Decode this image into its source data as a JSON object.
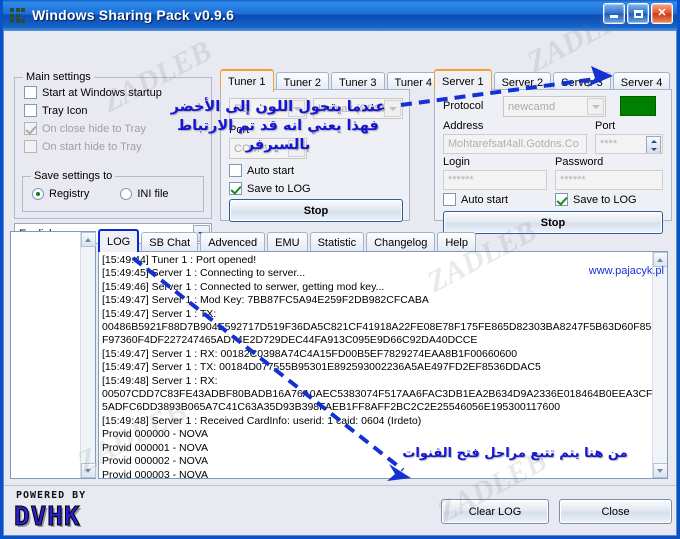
{
  "window": {
    "title": "Windows Sharing Pack v0.9.6",
    "icon": "app-grid-icon",
    "buttons": {
      "minimize": "minimize-icon",
      "maximize": "maximize-icon",
      "close": "close-icon"
    }
  },
  "main_settings": {
    "title": "Main settings",
    "checkboxes": [
      {
        "label": "Start at Windows startup",
        "checked": false,
        "enabled": true
      },
      {
        "label": "Tray Icon",
        "checked": false,
        "enabled": true
      },
      {
        "label": "On close hide to Tray",
        "checked": true,
        "enabled": false
      },
      {
        "label": "On start hide to Tray",
        "checked": false,
        "enabled": false
      }
    ],
    "save_settings": {
      "title": "Save settings to",
      "options": [
        {
          "label": "Registry",
          "selected": true
        },
        {
          "label": "INI file",
          "selected": false
        }
      ]
    },
    "language": {
      "value": "English"
    }
  },
  "tuner": {
    "tabs": [
      {
        "label": "Tuner 1",
        "active": true
      },
      {
        "label": "Tuner 2",
        "active": false
      },
      {
        "label": "Tuner 3",
        "active": false
      },
      {
        "label": "Tuner 4",
        "active": false
      }
    ],
    "protocol_combo": {
      "value": "RS",
      "enabled": false
    },
    "device_combo": {
      "value": "Humax (SSSP)",
      "enabled": false
    },
    "port_label": "Port",
    "port_combo": {
      "value": "COM 1",
      "enabled": false
    },
    "auto_start": {
      "label": "Auto start",
      "checked": false
    },
    "save_to_log": {
      "label": "Save to LOG",
      "checked": true
    },
    "action_button": "Stop"
  },
  "server": {
    "tabs": [
      {
        "label": "Server 1",
        "active": true
      },
      {
        "label": "Server 2",
        "active": false
      },
      {
        "label": "Server 3",
        "active": false
      },
      {
        "label": "Server 4",
        "active": false
      }
    ],
    "protocol_label": "Protocol",
    "protocol_value": "newcamd",
    "status_color": "#008000",
    "address_label": "Address",
    "address_value": "Mohtarefsat4all.Gotdns.Co",
    "port_label": "Port",
    "port_value": "****",
    "login_label": "Login",
    "login_value": "******",
    "password_label": "Password",
    "password_value": "******",
    "auto_start": {
      "label": "Auto start",
      "checked": false
    },
    "save_to_log": {
      "label": "Save to LOG",
      "checked": true
    },
    "action_button": "Stop"
  },
  "log_tabs": [
    {
      "label": "LOG",
      "active": true
    },
    {
      "label": "SB Chat",
      "active": false
    },
    {
      "label": "Advenced",
      "active": false
    },
    {
      "label": "EMU",
      "active": false
    },
    {
      "label": "Statistic",
      "active": false
    },
    {
      "label": "Changelog",
      "active": false
    },
    {
      "label": "Help",
      "active": false
    }
  ],
  "log_lines": [
    "[15:49:44] Tuner 1 : Port opened!",
    "[15:49:45] Server 1 : Connecting to server...",
    "[15:49:46] Server 1 : Connected to serwer, getting mod key...",
    "[15:49:47] Server 1 : Mod Key: 7BB87FC5A94E259F2DB982CFCABA",
    "[15:49:47] Server 1 : TX:",
    "00486B5921F88D7B904E592717D519F36DA5C821CF41918A22FE08E78F175FE865D82303BA8247F5B63D60F85",
    "F97360F4DF227247465AD74E2D729DEC44FA913C095E9D66C92DA40DCCE",
    "[15:49:47] Server 1 : RX: 00182C0398A74C4A15FD00B5EF7829274EAA8B1F00660600",
    "[15:49:47] Server 1 : TX: 00184D077555B95301E892593002236A5AE497FD2EF8536DDAC5",
    "[15:49:48] Server 1 : RX:",
    "00507CDD7C83FE43ADBF80BADB16A76A0AEC5383074F517AA6FAC3DB1EA2B634D9A2336E018464B0EEA3CF8",
    "5ADFC6DD3893B065A7C41C63A35D93B398FAEB1FF8AFF2BC2C2E25546056E195300117600",
    "[15:49:48] Server 1 : Received CardInfo: userid: 1 caid: 0604 (Irdeto)",
    "Provid 000000 - NOVA",
    "Provid 000001 - NOVA",
    "Provid 000002 - NOVA",
    "Provid 000003 - NOVA"
  ],
  "footer": {
    "powered_by": "POWERED BY",
    "brand": "DVHK",
    "clear_log_button": "Clear LOG",
    "close_button": "Close"
  },
  "link": {
    "pajacyk": "www.pajacyk.pl"
  },
  "annotations": {
    "top": "عندما يتحول اللون إلى الأخضر فهذا يعني انه قد تم الارتباط بالسيرفر",
    "bottom": "من هنا يتم تتبع مراحل فتح القنوات",
    "color": "#1414d2"
  },
  "watermark": "ZADLEB"
}
